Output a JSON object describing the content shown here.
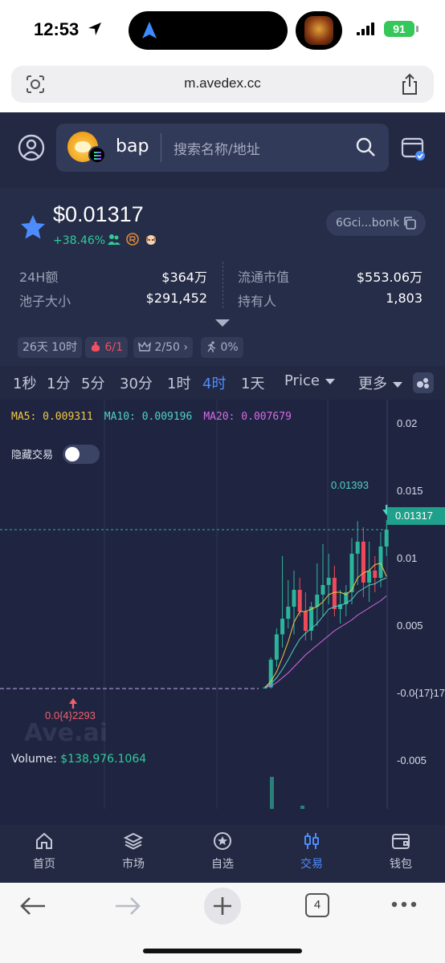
{
  "status_bar": {
    "time": "12:53",
    "battery": "91"
  },
  "browser": {
    "url": "m.avedex.cc",
    "tab_count": "4"
  },
  "header": {
    "token_name": "bap",
    "search_placeholder": "搜索名称/地址"
  },
  "token": {
    "price": "$0.01317",
    "change": "+38.46%",
    "address": "6Gci...bonk",
    "stats": [
      {
        "label": "24H额",
        "value": "$364万"
      },
      {
        "label": "流通市值",
        "value": "$553.06万"
      },
      {
        "label": "池子大小",
        "value": "$291,452"
      },
      {
        "label": "持有人",
        "value": "1,803"
      }
    ],
    "tags": {
      "age": "26天 10时",
      "risk": "6",
      "risk_total": "/1",
      "holders": "2/50",
      "tax": "0%"
    }
  },
  "timeframes": [
    "1秒",
    "1分",
    "5分",
    "30分",
    "1时",
    "4时",
    "1天"
  ],
  "active_timeframe": "4时",
  "price_select": "Price",
  "more": "更多",
  "chart_data": {
    "type": "candlestick",
    "timeframe": "4时",
    "indicators": {
      "MA5": "0.009311",
      "MA10": "0.009196",
      "MA20": "0.007679"
    },
    "ma_labels": {
      "ma5": "MA5: 0.009311",
      "ma10": "MA10: 0.009196",
      "ma20": "MA20: 0.007679"
    },
    "y_axis_ticks": [
      "0.02",
      "0.015",
      "0.01",
      "0.005",
      "-0.0{17}17",
      "-0.005"
    ],
    "ylim": [
      -0.006,
      0.022
    ],
    "current_price_label": "0.01317",
    "high_label": "0.01393",
    "low_label": "0.0{4}2293",
    "volume_label": "Volume:",
    "volume_value": "$138,976.1064",
    "hide_trades_label": "隐藏交易",
    "watermark": "Ave.ai",
    "candles": [
      {
        "o": 0.0,
        "h": 0.0002,
        "l": 0.0,
        "c": 0.0001
      },
      {
        "o": 0.0001,
        "h": 0.0026,
        "l": 0.0,
        "c": 0.0024
      },
      {
        "o": 0.0024,
        "h": 0.005,
        "l": 0.0018,
        "c": 0.0045
      },
      {
        "o": 0.0045,
        "h": 0.011,
        "l": 0.0034,
        "c": 0.0058
      },
      {
        "o": 0.0058,
        "h": 0.009,
        "l": 0.005,
        "c": 0.0068
      },
      {
        "o": 0.0068,
        "h": 0.0098,
        "l": 0.0045,
        "c": 0.0082
      },
      {
        "o": 0.0082,
        "h": 0.0092,
        "l": 0.006,
        "c": 0.0064
      },
      {
        "o": 0.0064,
        "h": 0.008,
        "l": 0.004,
        "c": 0.0048
      },
      {
        "o": 0.0048,
        "h": 0.0072,
        "l": 0.004,
        "c": 0.0068
      },
      {
        "o": 0.0068,
        "h": 0.0104,
        "l": 0.0052,
        "c": 0.0078
      },
      {
        "o": 0.0078,
        "h": 0.012,
        "l": 0.006,
        "c": 0.0086
      },
      {
        "o": 0.0086,
        "h": 0.0112,
        "l": 0.007,
        "c": 0.0092
      },
      {
        "o": 0.0092,
        "h": 0.0102,
        "l": 0.006,
        "c": 0.0066
      },
      {
        "o": 0.0066,
        "h": 0.0082,
        "l": 0.0054,
        "c": 0.007
      },
      {
        "o": 0.007,
        "h": 0.0086,
        "l": 0.006,
        "c": 0.008
      },
      {
        "o": 0.008,
        "h": 0.0125,
        "l": 0.007,
        "c": 0.0112
      },
      {
        "o": 0.0112,
        "h": 0.0139,
        "l": 0.0086,
        "c": 0.0122
      },
      {
        "o": 0.0122,
        "h": 0.0134,
        "l": 0.0076,
        "c": 0.0088
      },
      {
        "o": 0.0088,
        "h": 0.0122,
        "l": 0.0072,
        "c": 0.0098
      },
      {
        "o": 0.0098,
        "h": 0.011,
        "l": 0.008,
        "c": 0.0092
      },
      {
        "o": 0.0092,
        "h": 0.013,
        "l": 0.0084,
        "c": 0.0118
      },
      {
        "o": 0.0118,
        "h": 0.014,
        "l": 0.011,
        "c": 0.0132
      }
    ],
    "ma5": [
      0.0001,
      0.0006,
      0.0014,
      0.0026,
      0.0039,
      0.0055,
      0.0064,
      0.0064,
      0.0066,
      0.0068,
      0.0072,
      0.0078,
      0.008,
      0.008,
      0.0078,
      0.0082,
      0.0092,
      0.0096,
      0.0098,
      0.0103,
      0.0104,
      0.0093
    ],
    "ma10": [
      0.0001,
      0.0004,
      0.0009,
      0.0016,
      0.0024,
      0.0033,
      0.0041,
      0.0046,
      0.005,
      0.0054,
      0.006,
      0.0066,
      0.0068,
      0.0069,
      0.0071,
      0.0074,
      0.008,
      0.0083,
      0.0086,
      0.0087,
      0.009,
      0.0092
    ],
    "ma20": [
      0.0001,
      0.0002,
      0.0005,
      0.0009,
      0.0013,
      0.0018,
      0.0023,
      0.0028,
      0.0032,
      0.0036,
      0.004,
      0.0044,
      0.0048,
      0.0051,
      0.0054,
      0.0057,
      0.0061,
      0.0064,
      0.0067,
      0.007,
      0.0073,
      0.0077
    ]
  },
  "nav": [
    "首页",
    "市场",
    "自选",
    "交易",
    "钱包"
  ],
  "active_nav": "交易",
  "colors": {
    "up": "#2bb59a",
    "down": "#ef4a59",
    "accent": "#4d8cff",
    "bg": "#222840"
  }
}
